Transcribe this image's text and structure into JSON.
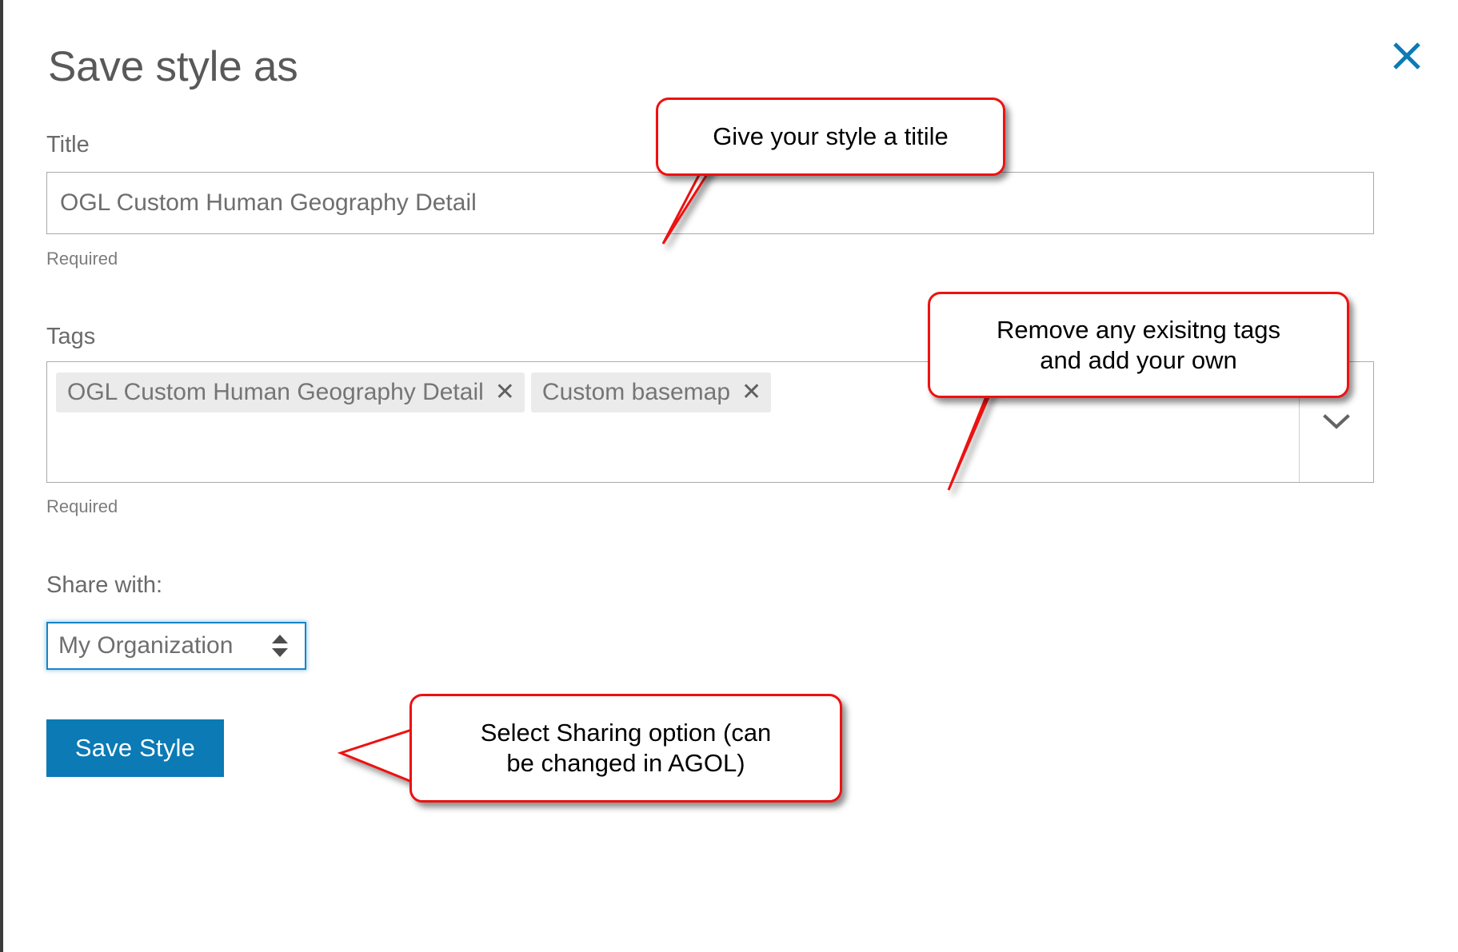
{
  "dialog": {
    "title": "Save style as",
    "close_icon": "close-icon",
    "close_color": "#0b7ab5"
  },
  "fields": {
    "title": {
      "label": "Title",
      "value": "OGL Custom Human Geography Detail",
      "placeholder": "Title",
      "helper": "Required"
    },
    "tags": {
      "label": "Tags",
      "helper": "Required",
      "chips": [
        {
          "text": "OGL Custom Human Geography Detail",
          "remove_label": "✕"
        },
        {
          "text": "Custom basemap",
          "remove_label": "✕"
        }
      ],
      "dropdown_icon": "chevron-down-icon"
    },
    "share": {
      "label": "Share with:",
      "selected": "My Organization",
      "options": [
        "My Organization"
      ],
      "stepper_icon": "stepper-updown-icon",
      "focus_color": "#1586c9"
    }
  },
  "actions": {
    "save_label": "Save Style",
    "save_color": "#0b7ab5"
  },
  "callouts": {
    "accent_color": "#ee1111",
    "title_note": "Give your style a titile",
    "tags_note_line1": "Remove any exisitng tags",
    "tags_note_line2": "and add your own",
    "share_note_line1": "Select Sharing option (can",
    "share_note_line2": "be changed in AGOL)"
  }
}
